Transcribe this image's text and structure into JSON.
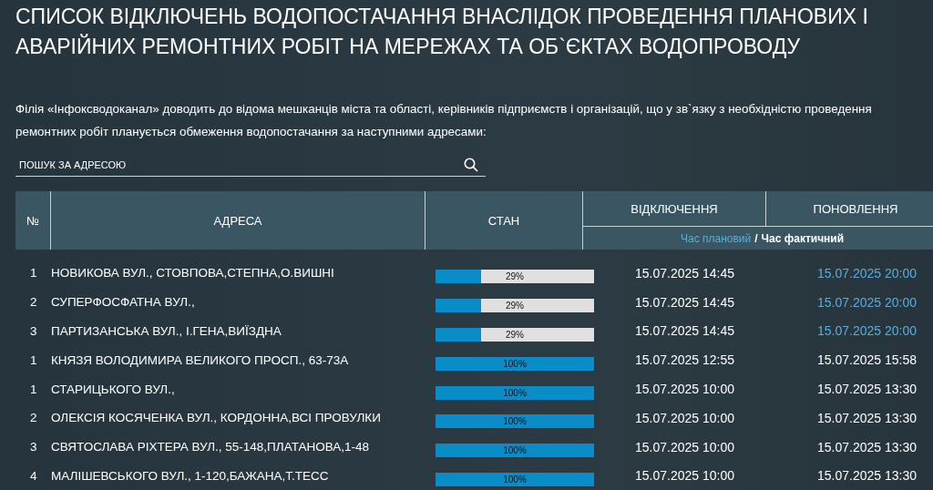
{
  "title": "СПИСОК ВІДКЛЮЧЕНЬ ВОДОПОСТАЧАННЯ ВНАСЛІДОК ПРОВЕДЕННЯ ПЛАНОВИХ І АВАРІЙНИХ РЕМОНТНИХ РОБІТ НА МЕРЕЖАХ ТА ОБ`ЄКТАХ ВОДОПРОВОДУ",
  "intro": "Філія «Інфоксводоканал» доводить до відома мешканців міста та області, керівників підприємств і організацій, що у зв`язку з необхідністю проведення ремонтних робіт планується обмеження водопостачання за наступними адресами:",
  "search": {
    "placeholder": "ПОШУК ЗА АДРЕСОЮ"
  },
  "table": {
    "columns": [
      "№",
      "АДРЕСА",
      "СТАН",
      "ВІДКЛЮЧЕННЯ",
      "ПОНОВЛЕННЯ"
    ],
    "legend": {
      "planned": "Час плановий",
      "separator": "/",
      "actual": "Час фактичний"
    },
    "rows": [
      {
        "number": "1",
        "address": "НОВИКОВА ВУЛ., СТОВПОВА,СТЕПНА,О.ВИШНІ",
        "level": 0.29,
        "percent": "29%",
        "off": "15.07.2025 14:45",
        "on": "15.07.2025 20:00",
        "planned": true
      },
      {
        "number": "2",
        "address": "СУПЕРФОСФАТНА ВУЛ.,",
        "level": 0.29,
        "percent": "29%",
        "off": "15.07.2025 14:45",
        "on": "15.07.2025 20:00",
        "planned": true
      },
      {
        "number": "3",
        "address": "ПАРТИЗАНСЬКА ВУЛ., І.ГЕНА,ВИЇЗДНА",
        "level": 0.29,
        "percent": "29%",
        "off": "15.07.2025 14:45",
        "on": "15.07.2025 20:00",
        "planned": true
      },
      {
        "number": "1",
        "address": "КНЯЗЯ ВОЛОДИМИРА ВЕЛИКОГО ПРОСП., 63-73А",
        "level": 1,
        "percent": "100%",
        "off": "15.07.2025 12:55",
        "on": "15.07.2025 15:58",
        "planned": false
      },
      {
        "number": "1",
        "address": "СТАРИЦЬКОГО ВУЛ.,",
        "level": 1,
        "percent": "100%",
        "off": "15.07.2025 10:00",
        "on": "15.07.2025 13:30",
        "planned": false
      },
      {
        "number": "2",
        "address": "ОЛЕКСІЯ КОСЯЧЕНКА ВУЛ., КОРДОННА,ВСІ ПРОВУЛКИ",
        "level": 1,
        "percent": "100%",
        "off": "15.07.2025 10:00",
        "on": "15.07.2025 13:30",
        "planned": false
      },
      {
        "number": "3",
        "address": "СВЯТОСЛАВА РІХТЕРА ВУЛ., 55-148,ПЛАТАНОВА,1-48",
        "level": 1,
        "percent": "100%",
        "off": "15.07.2025 10:00",
        "on": "15.07.2025 13:30",
        "planned": false
      },
      {
        "number": "4",
        "address": "МАЛІШЕВСЬКОГО ВУЛ., 1-120,БАЖАНА,Т.ТЕСС",
        "level": 1,
        "percent": "100%",
        "off": "15.07.2025 10:00",
        "on": "15.07.2025 13:30",
        "planned": false
      }
    ]
  }
}
